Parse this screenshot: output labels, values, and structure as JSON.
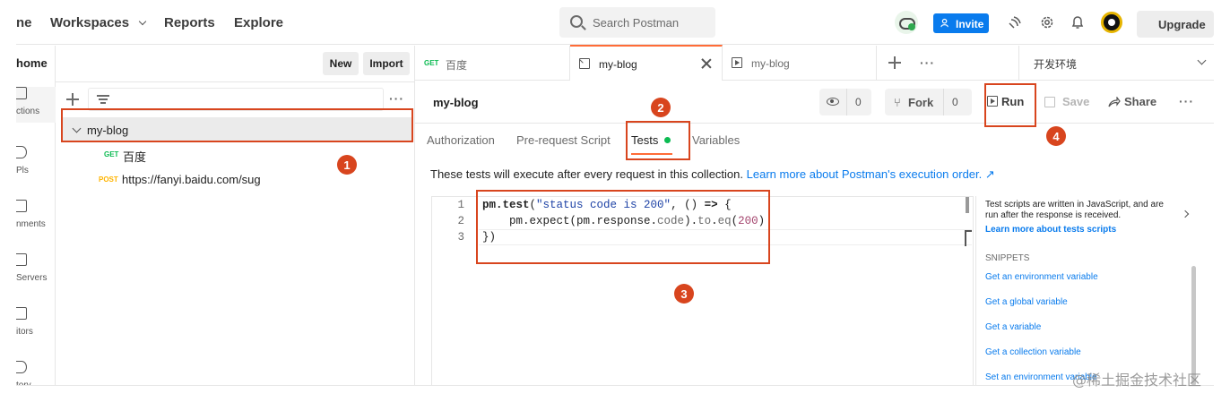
{
  "topbar": {
    "home_partial": "ne",
    "workspaces": "Workspaces",
    "reports": "Reports",
    "explore": "Explore",
    "search_placeholder": "Search Postman",
    "invite": "Invite",
    "upgrade": "Upgrade"
  },
  "rail": {
    "items": [
      "ctions",
      "Pls",
      "nments",
      "Servers",
      "itors",
      "tory"
    ]
  },
  "sidebar": {
    "workspace_title": "home",
    "new_label": "New",
    "import_label": "Import",
    "tree": {
      "collection": "my-blog",
      "requests": [
        {
          "method": "GET",
          "name": "百度"
        },
        {
          "method": "POST",
          "name": "https://fanyi.baidu.com/sug"
        }
      ]
    }
  },
  "tabs": [
    {
      "method": "GET",
      "label": "百度"
    },
    {
      "label": "my-blog"
    },
    {
      "label": "my-blog"
    }
  ],
  "environment": "开发环境",
  "main": {
    "collection_name": "my-blog",
    "watch_count": "0",
    "fork_label": "Fork",
    "fork_count": "0",
    "run_label": "Run",
    "save_label": "Save",
    "share_label": "Share",
    "content_tabs": [
      "Authorization",
      "Pre-request Script",
      "Tests",
      "Variables"
    ],
    "info_text": "These tests will execute after every request in this collection.",
    "info_link": "Learn more about Postman's execution order. ↗"
  },
  "editor": {
    "line_numbers": [
      "1",
      "2",
      "3"
    ]
  },
  "right_panel": {
    "description": "Test scripts are written in JavaScript, and are run after the response is received.",
    "learn_more": "Learn more about tests scripts",
    "snippets_title": "SNIPPETS",
    "snippets": [
      "Get an environment variable",
      "Get a global variable",
      "Get a variable",
      "Get a collection variable",
      "Set an environment variable"
    ]
  },
  "annotations": [
    "1",
    "2",
    "3",
    "4"
  ],
  "watermark": "@稀土掘金技术社区",
  "colors": {
    "accent": "#ff6c37",
    "annotation": "#d8451e",
    "link": "#097bed",
    "get": "#0cbb52",
    "post": "#ffb400"
  }
}
